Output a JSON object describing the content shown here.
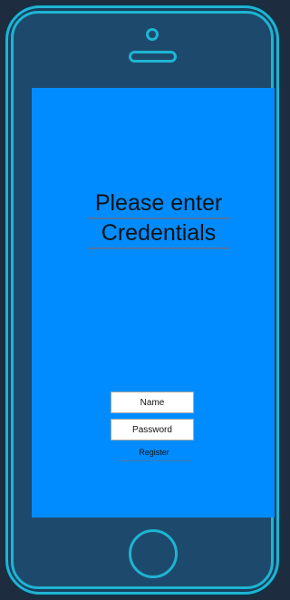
{
  "colors": {
    "frame_accent": "#1fb4d2",
    "screen_background": "#008cff",
    "page_background": "#1d2d3f"
  },
  "screen": {
    "heading_line_1": "Please enter",
    "heading_line_2": "Credentials"
  },
  "form": {
    "name_placeholder": "Name",
    "name_value": "",
    "password_placeholder": "Password",
    "password_value": "",
    "register_label": "Register"
  },
  "icons": {
    "camera": "front-camera",
    "speaker": "earpiece-speaker",
    "home": "home-button"
  }
}
